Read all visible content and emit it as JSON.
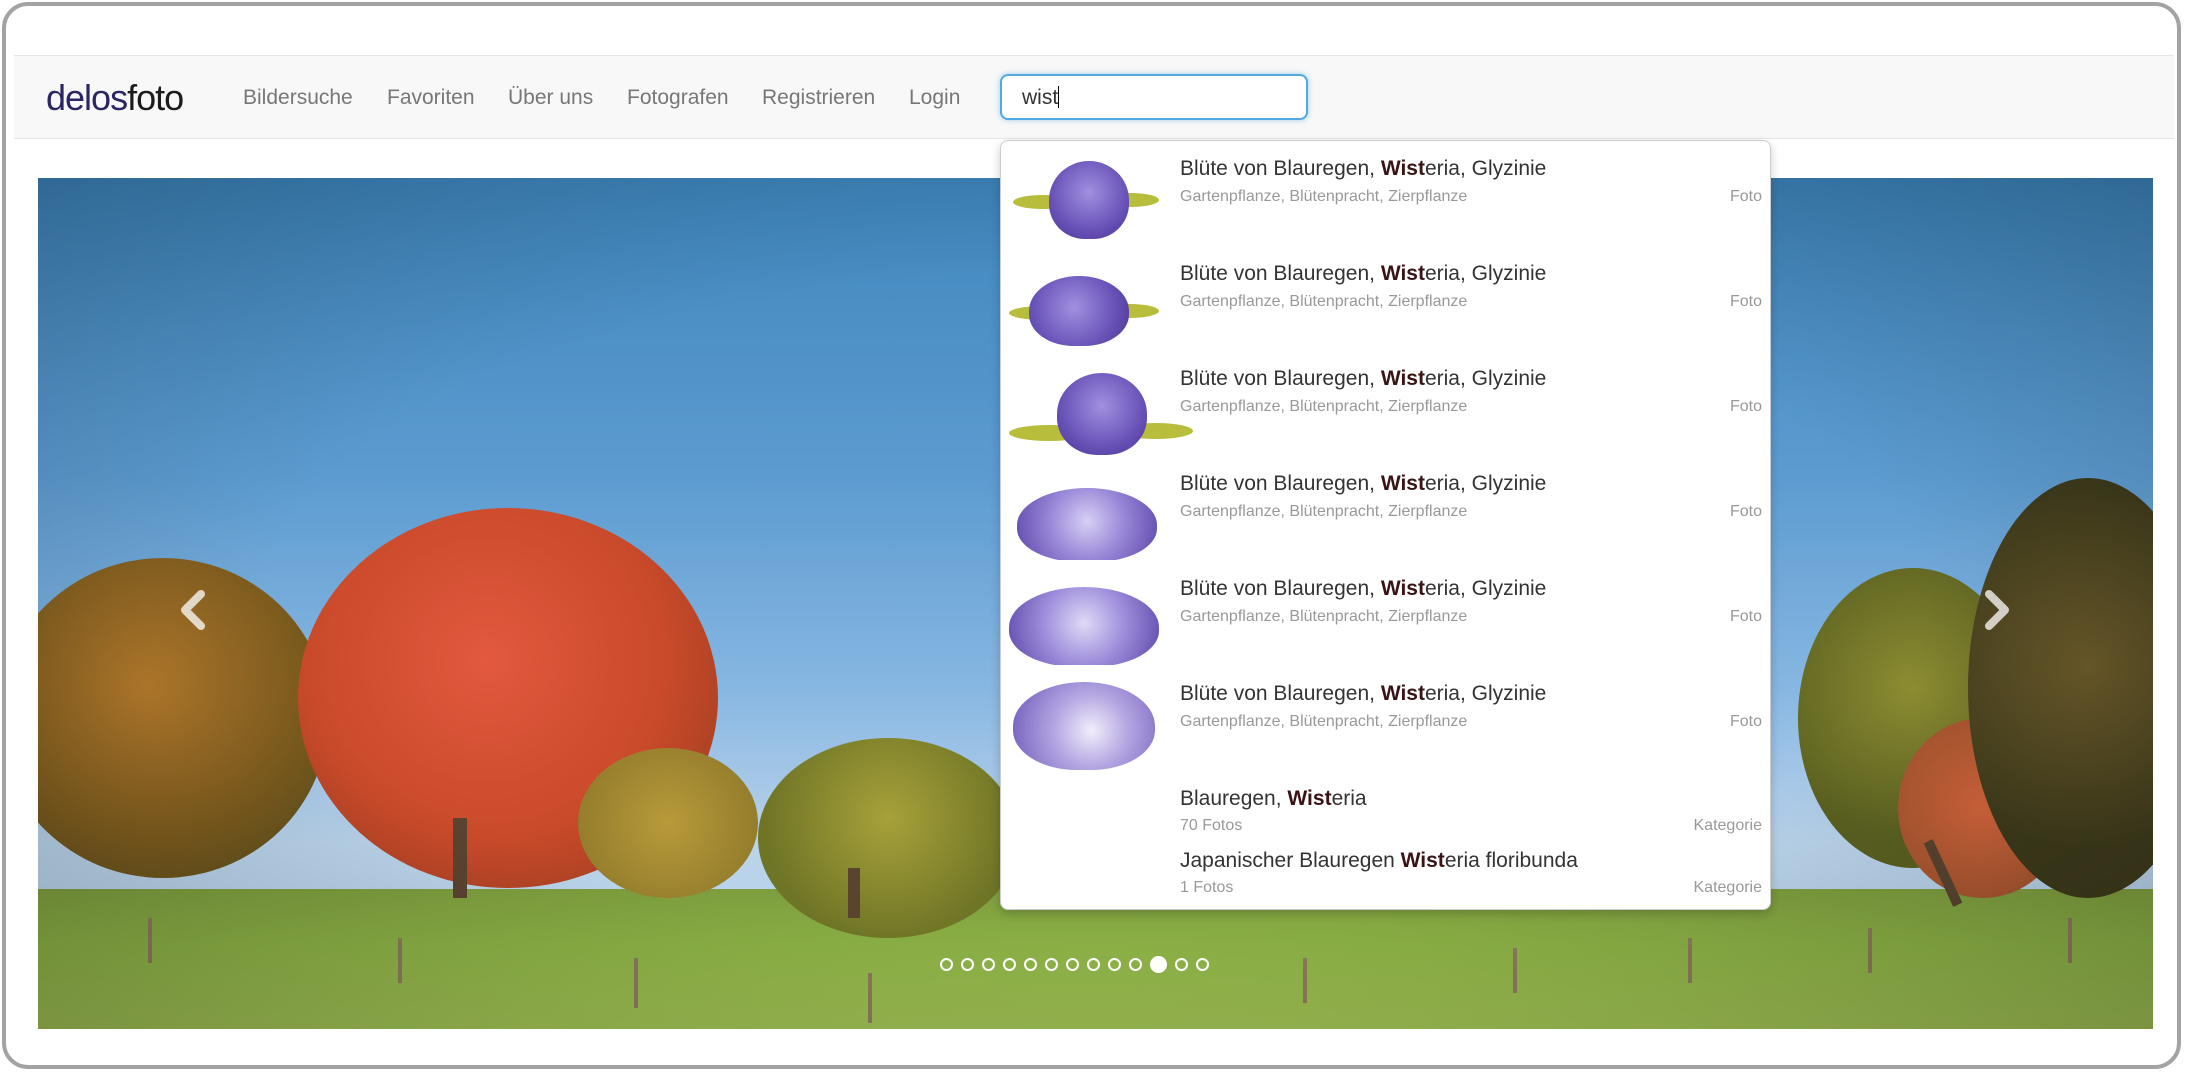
{
  "logo": {
    "part1": "delos",
    "part2": "foto"
  },
  "nav": [
    "Bildersuche",
    "Favoriten",
    "Über uns",
    "Fotografen",
    "Registrieren",
    "Login"
  ],
  "search": {
    "value": "wist"
  },
  "suggestions": [
    {
      "prefix": "Blüte von Blauregen, ",
      "match": "Wist",
      "suffix": "eria, Glyzinie",
      "tags": "Gartenpflanze, Blütenpracht, Zierpflanze",
      "type": "Foto"
    },
    {
      "prefix": "Blüte von Blauregen, ",
      "match": "Wist",
      "suffix": "eria, Glyzinie",
      "tags": "Gartenpflanze, Blütenpracht, Zierpflanze",
      "type": "Foto"
    },
    {
      "prefix": "Blüte von Blauregen, ",
      "match": "Wist",
      "suffix": "eria, Glyzinie",
      "tags": "Gartenpflanze, Blütenpracht, Zierpflanze",
      "type": "Foto"
    },
    {
      "prefix": "Blüte von Blauregen, ",
      "match": "Wist",
      "suffix": "eria, Glyzinie",
      "tags": "Gartenpflanze, Blütenpracht, Zierpflanze",
      "type": "Foto"
    },
    {
      "prefix": "Blüte von Blauregen, ",
      "match": "Wist",
      "suffix": "eria, Glyzinie",
      "tags": "Gartenpflanze, Blütenpracht, Zierpflanze",
      "type": "Foto"
    },
    {
      "prefix": "Blüte von Blauregen, ",
      "match": "Wist",
      "suffix": "eria, Glyzinie",
      "tags": "Gartenpflanze, Blütenpracht, Zierpflanze",
      "type": "Foto"
    }
  ],
  "categories": [
    {
      "prefix": "Blauregen, ",
      "match": "Wist",
      "suffix": "eria",
      "count": "70 Fotos",
      "type": "Kategorie"
    },
    {
      "prefix": "Japanischer Blauregen ",
      "match": "Wist",
      "suffix": "eria floribunda",
      "count": "1 Fotos",
      "type": "Kategorie"
    }
  ],
  "carousel": {
    "total_slides": 13,
    "active_index": 10
  },
  "icons": {
    "prev": "chevron-left-icon",
    "next": "chevron-right-icon"
  },
  "colors": {
    "logo_primary": "#2b2563",
    "search_focus": "#52a8e0",
    "match_text": "#3a1414"
  }
}
